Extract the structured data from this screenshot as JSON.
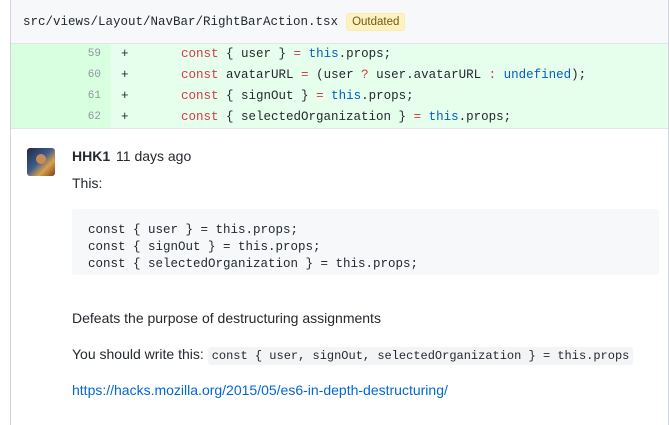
{
  "file": {
    "path": "src/views/Layout/NavBar/RightBarAction.tsx",
    "badge": "Outdated"
  },
  "diff": [
    {
      "num": "59",
      "sign": "+",
      "parts": [
        [
          "",
          "    "
        ],
        [
          "kw",
          "const"
        ],
        [
          "",
          " { user } "
        ],
        [
          "op",
          "="
        ],
        [
          "",
          " "
        ],
        [
          "bl",
          "this"
        ],
        [
          "",
          ".props;"
        ]
      ]
    },
    {
      "num": "60",
      "sign": "+",
      "parts": [
        [
          "",
          "    "
        ],
        [
          "kw",
          "const"
        ],
        [
          "",
          " avatarURL "
        ],
        [
          "op",
          "="
        ],
        [
          "",
          " (user "
        ],
        [
          "op",
          "?"
        ],
        [
          "",
          " user.avatarURL "
        ],
        [
          "op",
          ":"
        ],
        [
          "",
          " "
        ],
        [
          "bl",
          "undefined"
        ],
        [
          "",
          ");"
        ]
      ]
    },
    {
      "num": "61",
      "sign": "+",
      "parts": [
        [
          "",
          "    "
        ],
        [
          "kw",
          "const"
        ],
        [
          "",
          " { signOut } "
        ],
        [
          "op",
          "="
        ],
        [
          "",
          " "
        ],
        [
          "bl",
          "this"
        ],
        [
          "",
          ".props;"
        ]
      ]
    },
    {
      "num": "62",
      "sign": "+",
      "parts": [
        [
          "",
          "    "
        ],
        [
          "kw",
          "const"
        ],
        [
          "",
          " { selectedOrganization } "
        ],
        [
          "op",
          "="
        ],
        [
          "",
          " "
        ],
        [
          "bl",
          "this"
        ],
        [
          "",
          ".props;"
        ]
      ]
    }
  ],
  "comment": {
    "author": "HHK1",
    "time": "11 days ago",
    "intro": "This:",
    "code": "const { user } = this.props;\nconst { signOut } = this.props;\nconst { selectedOrganization } = this.props;",
    "defeats": "Defeats the purpose of destructuring assignments",
    "suggest_text": "You should write this: ",
    "suggest_code": "const { user, signOut, selectedOrganization } = this.props",
    "link": "https://hacks.mozilla.org/2015/05/es6-in-depth-destructuring/"
  },
  "colors": {
    "added_line_bg": "#e6ffed",
    "added_num_bg": "#cdffd8",
    "keyword": "#d73a49",
    "builtin": "#005cc5",
    "link": "#0366d6",
    "badge_bg": "#fff1c2"
  }
}
